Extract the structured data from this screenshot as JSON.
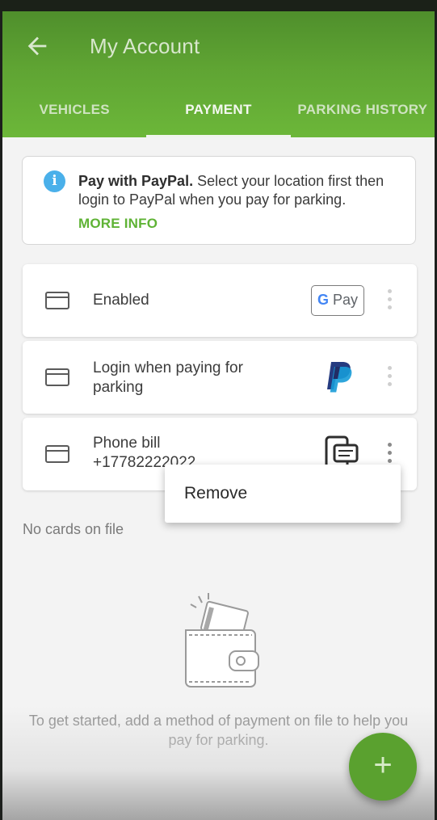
{
  "header": {
    "title": "My Account",
    "back_icon": "arrow-left-icon"
  },
  "tabs": [
    {
      "label": "VEHICLES",
      "active": false
    },
    {
      "label": "PAYMENT",
      "active": true
    },
    {
      "label": "PARKING HISTORY",
      "active": false
    }
  ],
  "info": {
    "bold": "Pay with PayPal.",
    "text": " Select your location first then login to PayPal when you pay for parking.",
    "link": "MORE INFO"
  },
  "methods": [
    {
      "line1": "Enabled",
      "line2": "",
      "brand": "G Pay",
      "brand_g": "G",
      "brand_rest": "Pay"
    },
    {
      "line1": "Login when paying for",
      "line2": "parking",
      "brand": "paypal-logo"
    },
    {
      "line1": "Phone bill",
      "line2": "+17782222022",
      "brand": "phone-bill-icon"
    }
  ],
  "menu": {
    "item": "Remove"
  },
  "no_cards": "No cards on file",
  "empty": {
    "text": "To get started, add a method of payment on file to help you pay for parking."
  },
  "fab": {
    "label": "+"
  },
  "colors": {
    "header_green": "#5fa433",
    "accent_green": "#5fb335",
    "info_blue": "#4ab0ea"
  }
}
